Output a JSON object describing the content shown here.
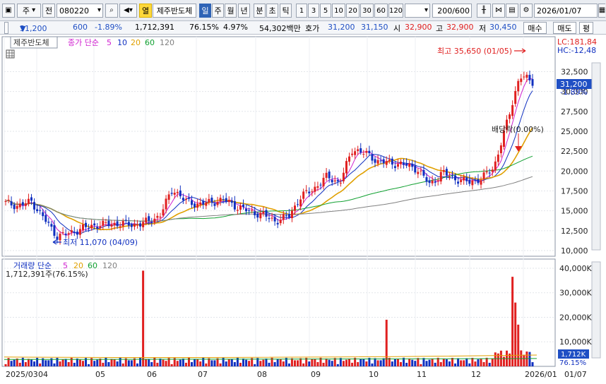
{
  "toolbar": {
    "mode": "주",
    "type": "전",
    "code": "080220",
    "tag": "열",
    "name": "제주반도체",
    "periods": [
      "일",
      "주",
      "월",
      "년",
      "분",
      "초",
      "틱"
    ],
    "minutes": [
      "1",
      "3",
      "5",
      "10",
      "20",
      "30",
      "60",
      "120"
    ],
    "count": "200",
    "count_total": "/600",
    "date": "2026/01/07"
  },
  "info": {
    "price": "31,200",
    "change": "600",
    "pct": "-1.89%",
    "volume": "1,712,391",
    "vol_ratio": "76.15%",
    "turnover": "4.97%",
    "amount": "54,302백만",
    "quote_label": "호가",
    "ask": "31,200",
    "bid": "31,150",
    "open_label": "시",
    "open": "32,900",
    "high_label": "고",
    "high": "32,900",
    "low_label": "저",
    "low": "30,450",
    "buy_btn": "매수",
    "sell_btn": "매도",
    "eval_btn": "평"
  },
  "chart": {
    "title": "제주반도체",
    "ma_label": "종가 단순",
    "ma_periods": [
      "5",
      "10",
      "20",
      "60",
      "120"
    ],
    "ma_colors": [
      "#d020d0",
      "#1030c0",
      "#e0a000",
      "#10a030",
      "#808080"
    ],
    "lc": "LC:181,84",
    "hc": "HC:-12,48",
    "price_ticks": [
      "32,500",
      "30,000",
      "27,500",
      "25,000",
      "22,500",
      "20,000",
      "17,500",
      "15,000",
      "12,500",
      "10,000"
    ],
    "price_box": "31,200",
    "price_pct": "-1.89%",
    "high_note": "최고 35,650 (01/05)",
    "low_note": "최저 11,070 (04/09)",
    "dividend_note": "배당락(0.00%)",
    "vol_label": "거래량 단순",
    "vol_ma": [
      "5",
      "20",
      "60",
      "120"
    ],
    "vol_info": "1,712,391주(76.15%)",
    "vol_ticks": [
      "40,000K",
      "30,000K",
      "20,000K",
      "10,000K"
    ],
    "vol_box": "1,712K",
    "vol_pct": "76.15%",
    "x_ticks": [
      "2025/03",
      "04",
      "05",
      "06",
      "07",
      "08",
      "09",
      "10",
      "11",
      "12",
      "2026/01",
      "01/07"
    ]
  },
  "chart_data": {
    "type": "candlestick",
    "period": "daily",
    "start": "2025/03",
    "end": "2026/01/07",
    "ylim": [
      10000,
      36000
    ],
    "last_close": 31200,
    "high": {
      "value": 35650,
      "date": "01/05"
    },
    "low": {
      "value": 11070,
      "date": "04/09"
    },
    "price_path": [
      [
        "2025/03",
        16000
      ],
      [
        "03",
        15600
      ],
      [
        "03",
        16200
      ],
      [
        "04",
        14000
      ],
      [
        "04",
        11800
      ],
      [
        "04/09",
        12200
      ],
      [
        "04",
        12800
      ],
      [
        "05",
        13200
      ],
      [
        "05",
        13300
      ],
      [
        "05",
        13400
      ],
      [
        "06",
        13200
      ],
      [
        "06",
        13600
      ],
      [
        "06",
        14400
      ],
      [
        "06",
        17800
      ],
      [
        "07",
        16200
      ],
      [
        "07",
        15800
      ],
      [
        "07",
        16100
      ],
      [
        "07",
        16400
      ],
      [
        "08",
        15500
      ],
      [
        "08",
        14900
      ],
      [
        "08",
        14500
      ],
      [
        "08",
        13700
      ],
      [
        "09",
        14300
      ],
      [
        "09",
        16800
      ],
      [
        "09",
        17800
      ],
      [
        "09",
        19300
      ],
      [
        "10",
        18500
      ],
      [
        "10",
        22800
      ],
      [
        "10",
        22200
      ],
      [
        "10",
        21200
      ],
      [
        "11",
        21000
      ],
      [
        "11",
        20800
      ],
      [
        "11",
        20300
      ],
      [
        "11",
        18300
      ],
      [
        "12",
        19800
      ],
      [
        "12",
        19000
      ],
      [
        "12",
        18600
      ],
      [
        "12",
        19000
      ],
      [
        "2026/01",
        20500
      ],
      [
        "01",
        26000
      ],
      [
        "01/05",
        32000
      ],
      [
        "01/07",
        31200
      ]
    ],
    "volume_peaks_k": [
      [
        "06",
        39000
      ],
      [
        "10",
        19000
      ],
      [
        "2026/01",
        36500
      ],
      [
        "01/07",
        1712
      ]
    ]
  }
}
